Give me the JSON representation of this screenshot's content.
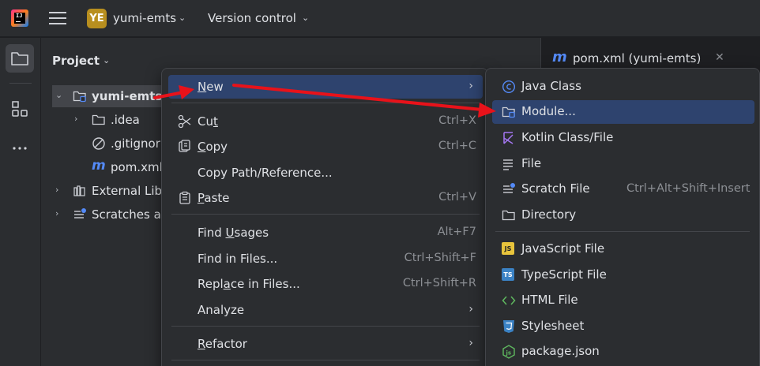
{
  "topbar": {
    "project_badge": "YE",
    "project_name": "yumi-emts",
    "vcs_label": "Version control"
  },
  "project_panel": {
    "title": "Project",
    "tree": [
      {
        "label": "yumi-emts",
        "icon": "module-folder-icon",
        "expanded": true,
        "selected": true
      },
      {
        "label": ".idea",
        "icon": "folder-icon",
        "expanded": false
      },
      {
        "label": ".gitignor",
        "icon": "ignore-file-icon"
      },
      {
        "label": "pom.xml",
        "icon": "maven-icon"
      },
      {
        "label": "External Libr",
        "icon": "library-icon",
        "expanded": false
      },
      {
        "label": "Scratches ar",
        "icon": "scratches-icon",
        "expanded": false
      }
    ]
  },
  "editor": {
    "tab_label": "pom.xml (yumi-emts)"
  },
  "context_menu": {
    "items": [
      {
        "label_pre": "",
        "label_u": "N",
        "label_post": "ew",
        "shortcut": "",
        "submenu": true,
        "highlight": true
      },
      {
        "label_pre": "Cu",
        "label_u": "t",
        "label_post": "",
        "shortcut": "Ctrl+X",
        "icon": "scissors-icon"
      },
      {
        "label_pre": "",
        "label_u": "C",
        "label_post": "opy",
        "shortcut": "Ctrl+C",
        "icon": "copy-icon"
      },
      {
        "label": "Copy Path/Reference...",
        "shortcut": ""
      },
      {
        "label_pre": "",
        "label_u": "P",
        "label_post": "aste",
        "shortcut": "Ctrl+V",
        "icon": "paste-icon"
      },
      {
        "label_pre": "Find ",
        "label_u": "U",
        "label_post": "sages",
        "shortcut": "Alt+F7"
      },
      {
        "label": "Find in Files...",
        "shortcut": "Ctrl+Shift+F"
      },
      {
        "label_pre": "Repl",
        "label_u": "a",
        "label_post": "ce in Files...",
        "shortcut": "Ctrl+Shift+R"
      },
      {
        "label": "Analyze",
        "shortcut": "",
        "submenu": true
      },
      {
        "label_pre": "",
        "label_u": "R",
        "label_post": "efactor",
        "shortcut": "",
        "submenu": true
      }
    ]
  },
  "new_submenu": {
    "items": [
      {
        "label": "Java Class",
        "icon": "java-class-icon"
      },
      {
        "label": "Module...",
        "icon": "module-icon",
        "highlight": true
      },
      {
        "label": "Kotlin Class/File",
        "icon": "kotlin-icon"
      },
      {
        "label": "File",
        "icon": "file-icon"
      },
      {
        "label": "Scratch File",
        "icon": "scratch-file-icon",
        "shortcut": "Ctrl+Alt+Shift+Insert"
      },
      {
        "label": "Directory",
        "icon": "directory-icon"
      },
      {
        "label": "JavaScript File",
        "icon": "javascript-icon",
        "badge": "JS"
      },
      {
        "label": "TypeScript File",
        "icon": "typescript-icon",
        "badge": "TS"
      },
      {
        "label": "HTML File",
        "icon": "html-icon"
      },
      {
        "label": "Stylesheet",
        "icon": "css-icon"
      },
      {
        "label": "package.json",
        "icon": "nodejs-icon"
      }
    ]
  },
  "colors": {
    "background": "#1e1f22",
    "panel": "#2b2d30",
    "highlight": "#2e436e",
    "annotation_arrow": "#e8121a"
  }
}
